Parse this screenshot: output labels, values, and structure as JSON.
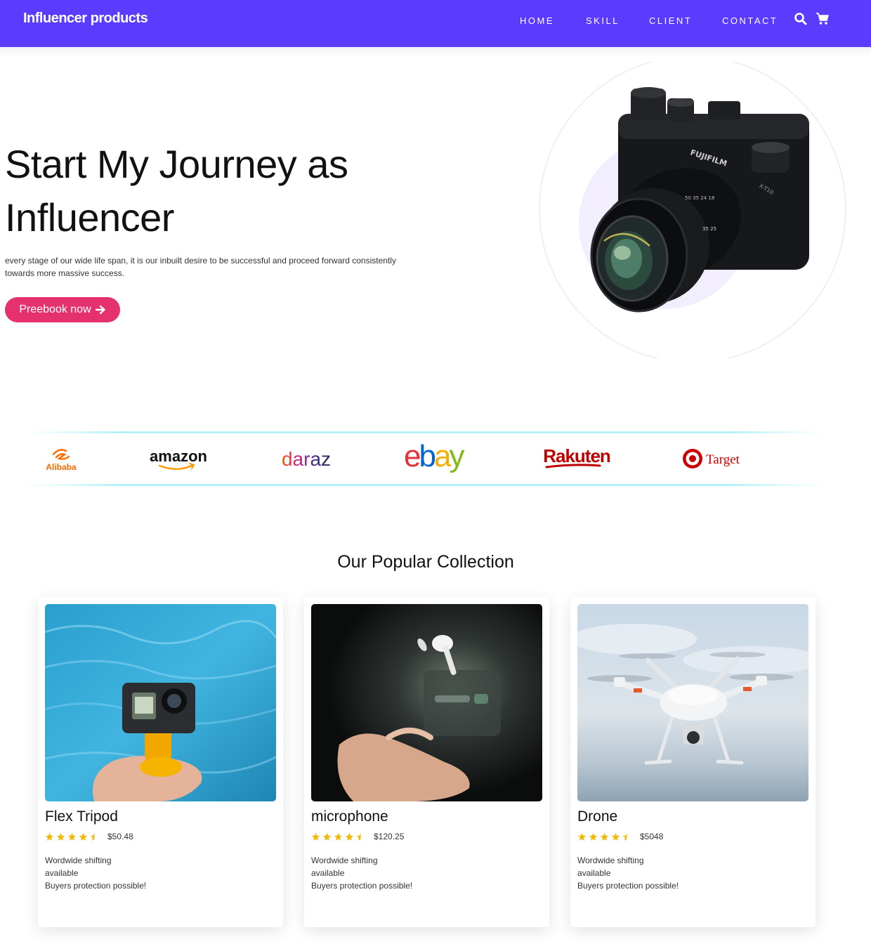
{
  "nav": {
    "brand": "Influencer products",
    "links": [
      "HOME",
      "SKILL",
      "CLIENT",
      "CONTACT"
    ],
    "icons": [
      "search-icon",
      "cart-icon"
    ],
    "background": "#5b3cff"
  },
  "hero": {
    "title": "Start My Journey as Influencer",
    "text": "every stage of our wide life span, it is our inbuilt desire to be successful and proceed forward consistently towards more massive success.",
    "cta_label": "Preebook now",
    "cta_icon": "arrow-right-icon",
    "cta_color": "#e5316d",
    "image": "fujifilm-camera-image"
  },
  "brands": [
    "Alibaba",
    "amazon",
    "daraz",
    "ebay",
    "Rakuten",
    "Target"
  ],
  "collection": {
    "title": "Our Popular Collection",
    "products": [
      {
        "name": "Flex Tripod",
        "price": "$50.48",
        "rating": 4.5,
        "image": "action-camera-in-water-image",
        "desc": [
          "Wordwide shifting",
          "available",
          "Buyers protection possible!"
        ]
      },
      {
        "name": "microphone",
        "price": "$120.25",
        "rating": 4.5,
        "image": "floating-earbud-image",
        "desc": [
          "Wordwide shifting",
          "available",
          "Buyers protection possible!"
        ]
      },
      {
        "name": "Drone",
        "price": "$5048",
        "rating": 4.5,
        "image": "drone-in-sky-image",
        "desc": [
          "Wordwide shifting",
          "available",
          "Buyers protection possible!"
        ]
      }
    ],
    "star_color": "#f2b90c"
  }
}
